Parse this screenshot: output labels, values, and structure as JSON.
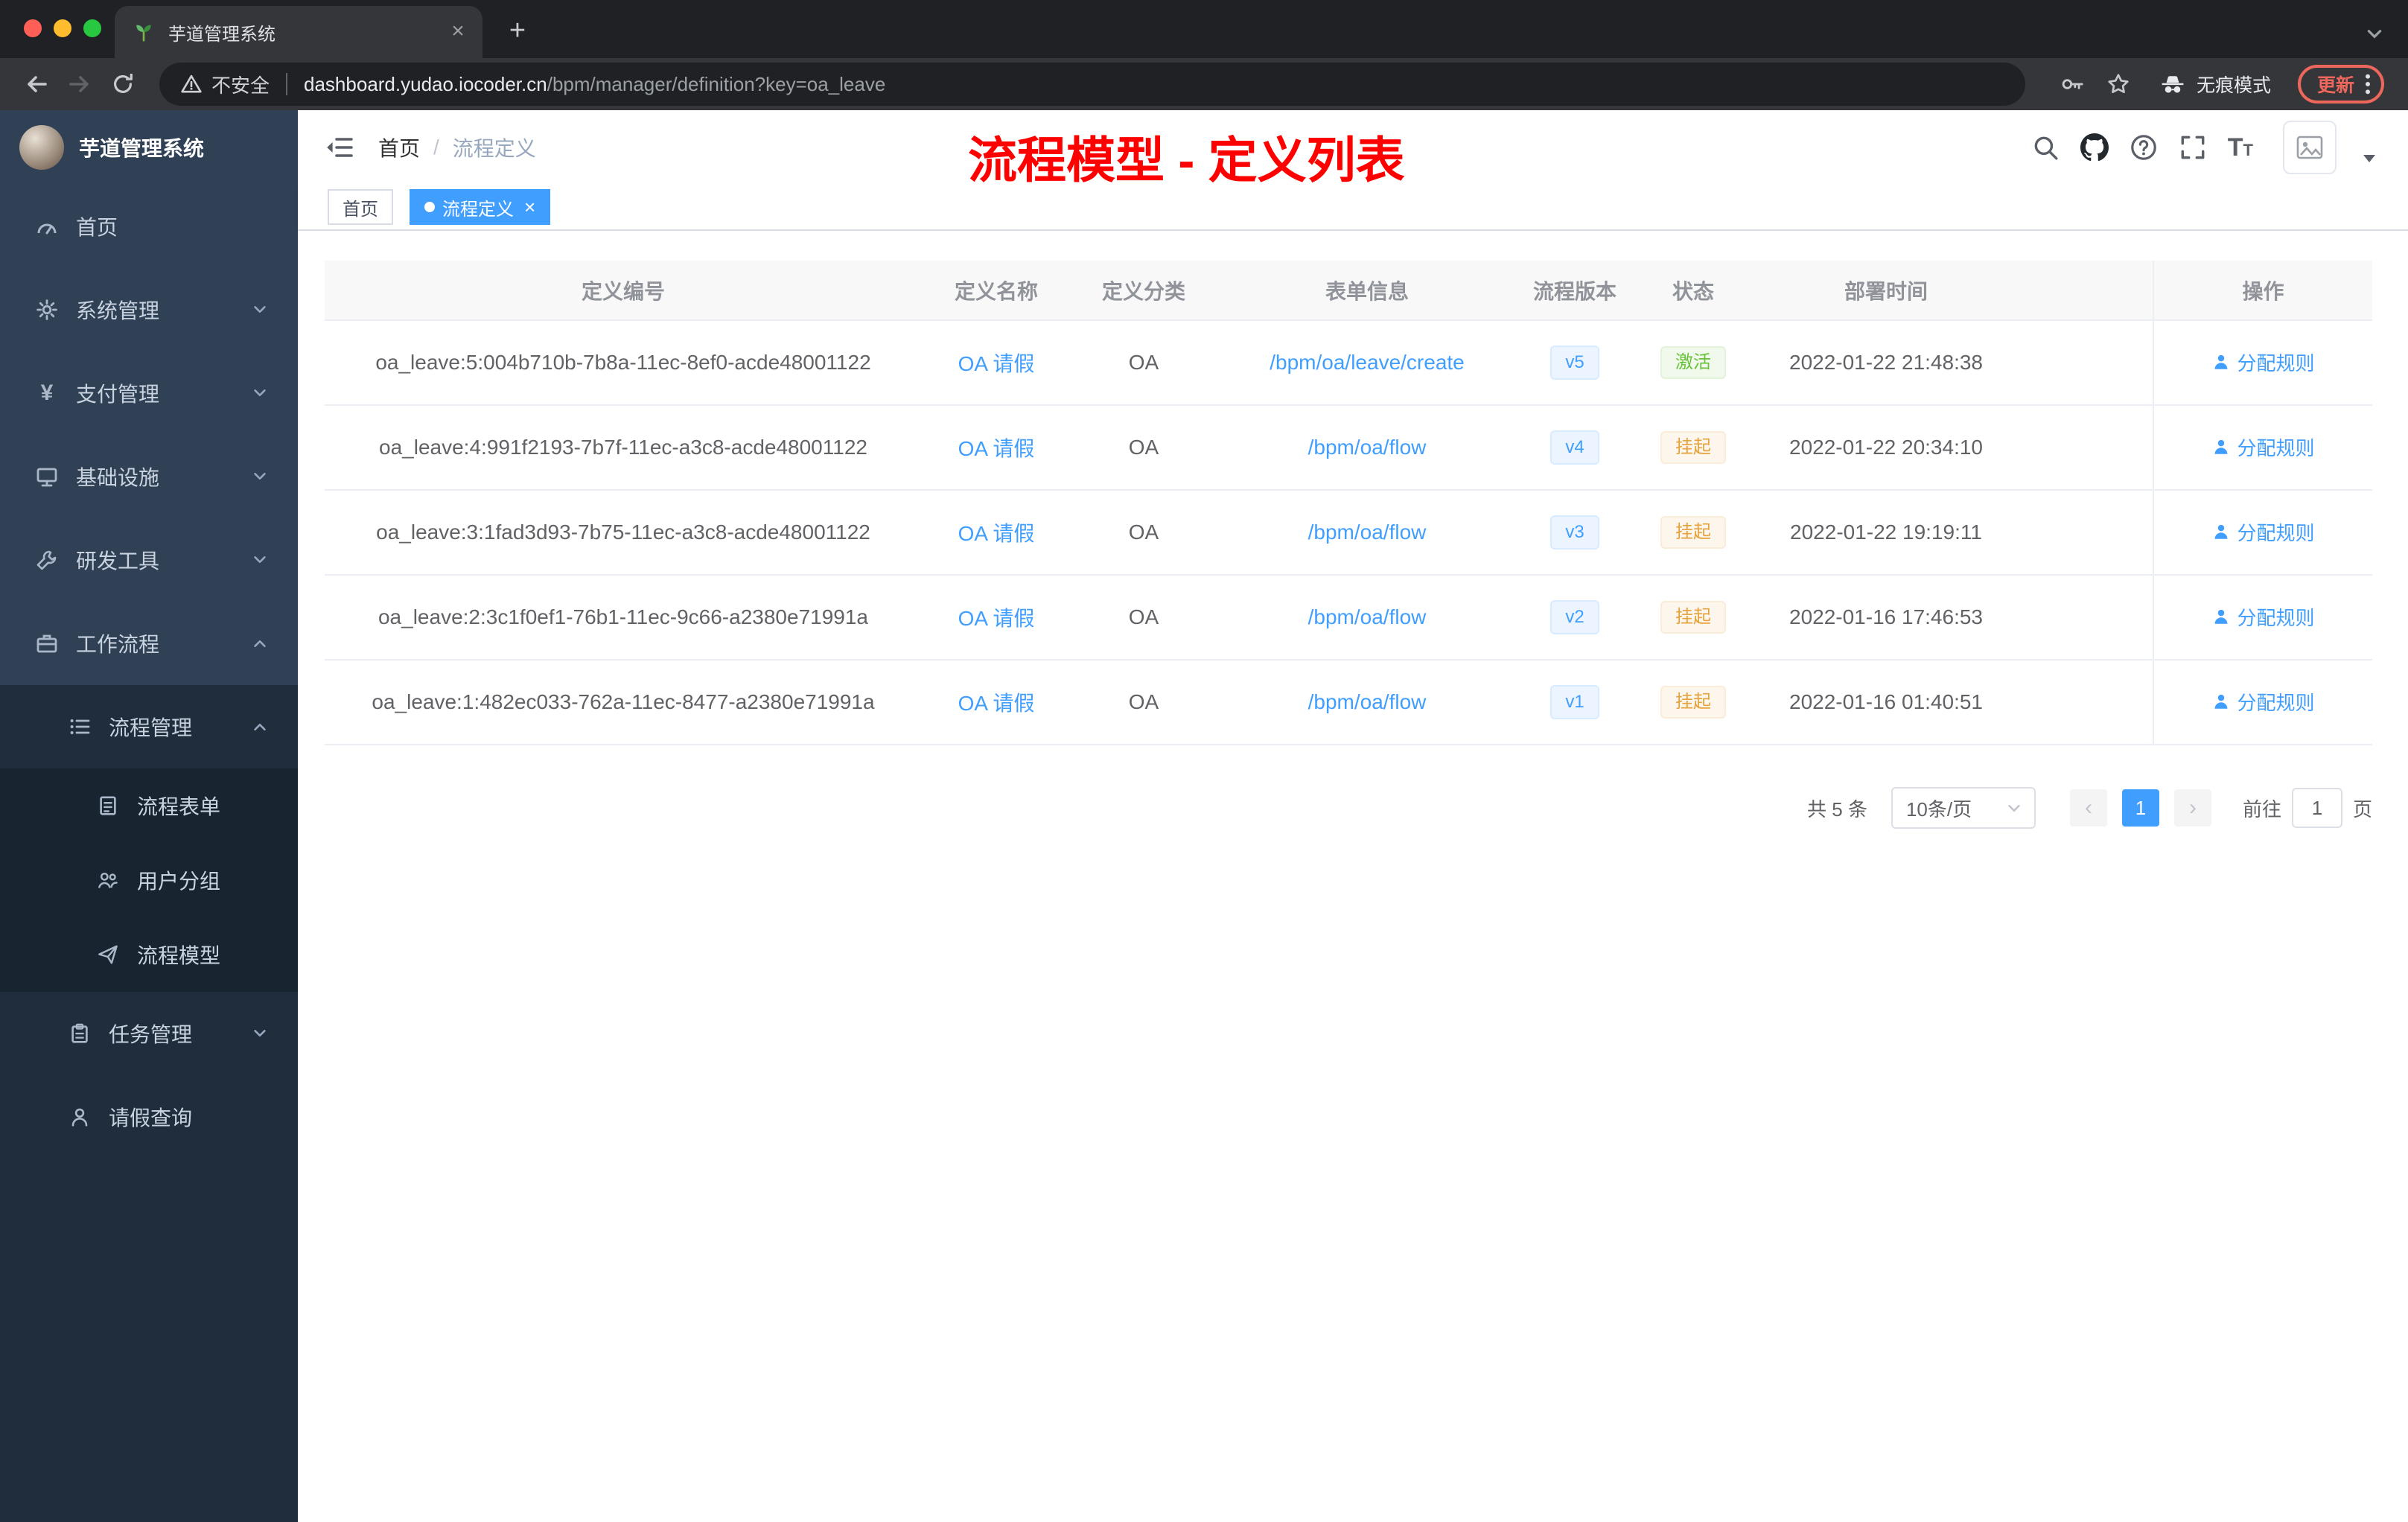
{
  "colors": {
    "accent": "#409eff",
    "success": "#67c23a",
    "warning": "#e6a23c",
    "annotation": "#ff0000",
    "sidebar": "#304156"
  },
  "browser": {
    "tab_title": "芋道管理系统",
    "security_label": "不安全",
    "url_domain": "dashboard.yudao.iocoder.cn",
    "url_path": "/bpm/manager/definition?key=oa_leave",
    "incognito_label": "无痕模式",
    "update_label": "更新"
  },
  "sidebar": {
    "logo_title": "芋道管理系统",
    "items": [
      {
        "label": "首页"
      },
      {
        "label": "系统管理"
      },
      {
        "label": "支付管理"
      },
      {
        "label": "基础设施"
      },
      {
        "label": "研发工具"
      },
      {
        "label": "工作流程"
      },
      {
        "label": "流程管理"
      },
      {
        "label": "流程表单"
      },
      {
        "label": "用户分组"
      },
      {
        "label": "流程模型"
      },
      {
        "label": "任务管理"
      },
      {
        "label": "请假查询"
      }
    ]
  },
  "header": {
    "breadcrumb_home": "首页",
    "breadcrumb_separator": "/",
    "breadcrumb_current": "流程定义",
    "annotation": "流程模型 - 定义列表"
  },
  "tags": {
    "home": "首页",
    "active": "流程定义"
  },
  "table": {
    "columns": [
      "定义编号",
      "定义名称",
      "定义分类",
      "表单信息",
      "流程版本",
      "状态",
      "部署时间",
      "操作"
    ],
    "rows": [
      {
        "id": "oa_leave:5:004b710b-7b8a-11ec-8ef0-acde48001122",
        "name": "OA 请假",
        "category": "OA",
        "form": "/bpm/oa/leave/create",
        "version": "v5",
        "status": "激活",
        "status_type": "success",
        "deploy_time": "2022-01-22 21:48:38",
        "action": "分配规则"
      },
      {
        "id": "oa_leave:4:991f2193-7b7f-11ec-a3c8-acde48001122",
        "name": "OA 请假",
        "category": "OA",
        "form": "/bpm/oa/flow",
        "version": "v4",
        "status": "挂起",
        "status_type": "warning",
        "deploy_time": "2022-01-22 20:34:10",
        "action": "分配规则"
      },
      {
        "id": "oa_leave:3:1fad3d93-7b75-11ec-a3c8-acde48001122",
        "name": "OA 请假",
        "category": "OA",
        "form": "/bpm/oa/flow",
        "version": "v3",
        "status": "挂起",
        "status_type": "warning",
        "deploy_time": "2022-01-22 19:19:11",
        "action": "分配规则"
      },
      {
        "id": "oa_leave:2:3c1f0ef1-76b1-11ec-9c66-a2380e71991a",
        "name": "OA 请假",
        "category": "OA",
        "form": "/bpm/oa/flow",
        "version": "v2",
        "status": "挂起",
        "status_type": "warning",
        "deploy_time": "2022-01-16 17:46:53",
        "action": "分配规则"
      },
      {
        "id": "oa_leave:1:482ec033-762a-11ec-8477-a2380e71991a",
        "name": "OA 请假",
        "category": "OA",
        "form": "/bpm/oa/flow",
        "version": "v1",
        "status": "挂起",
        "status_type": "warning",
        "deploy_time": "2022-01-16 01:40:51",
        "action": "分配规则"
      }
    ]
  },
  "pagination": {
    "total": "共 5 条",
    "page_size": "10条/页",
    "current_page": "1",
    "goto_label": "前往",
    "goto_value": "1",
    "page_unit": "页"
  }
}
